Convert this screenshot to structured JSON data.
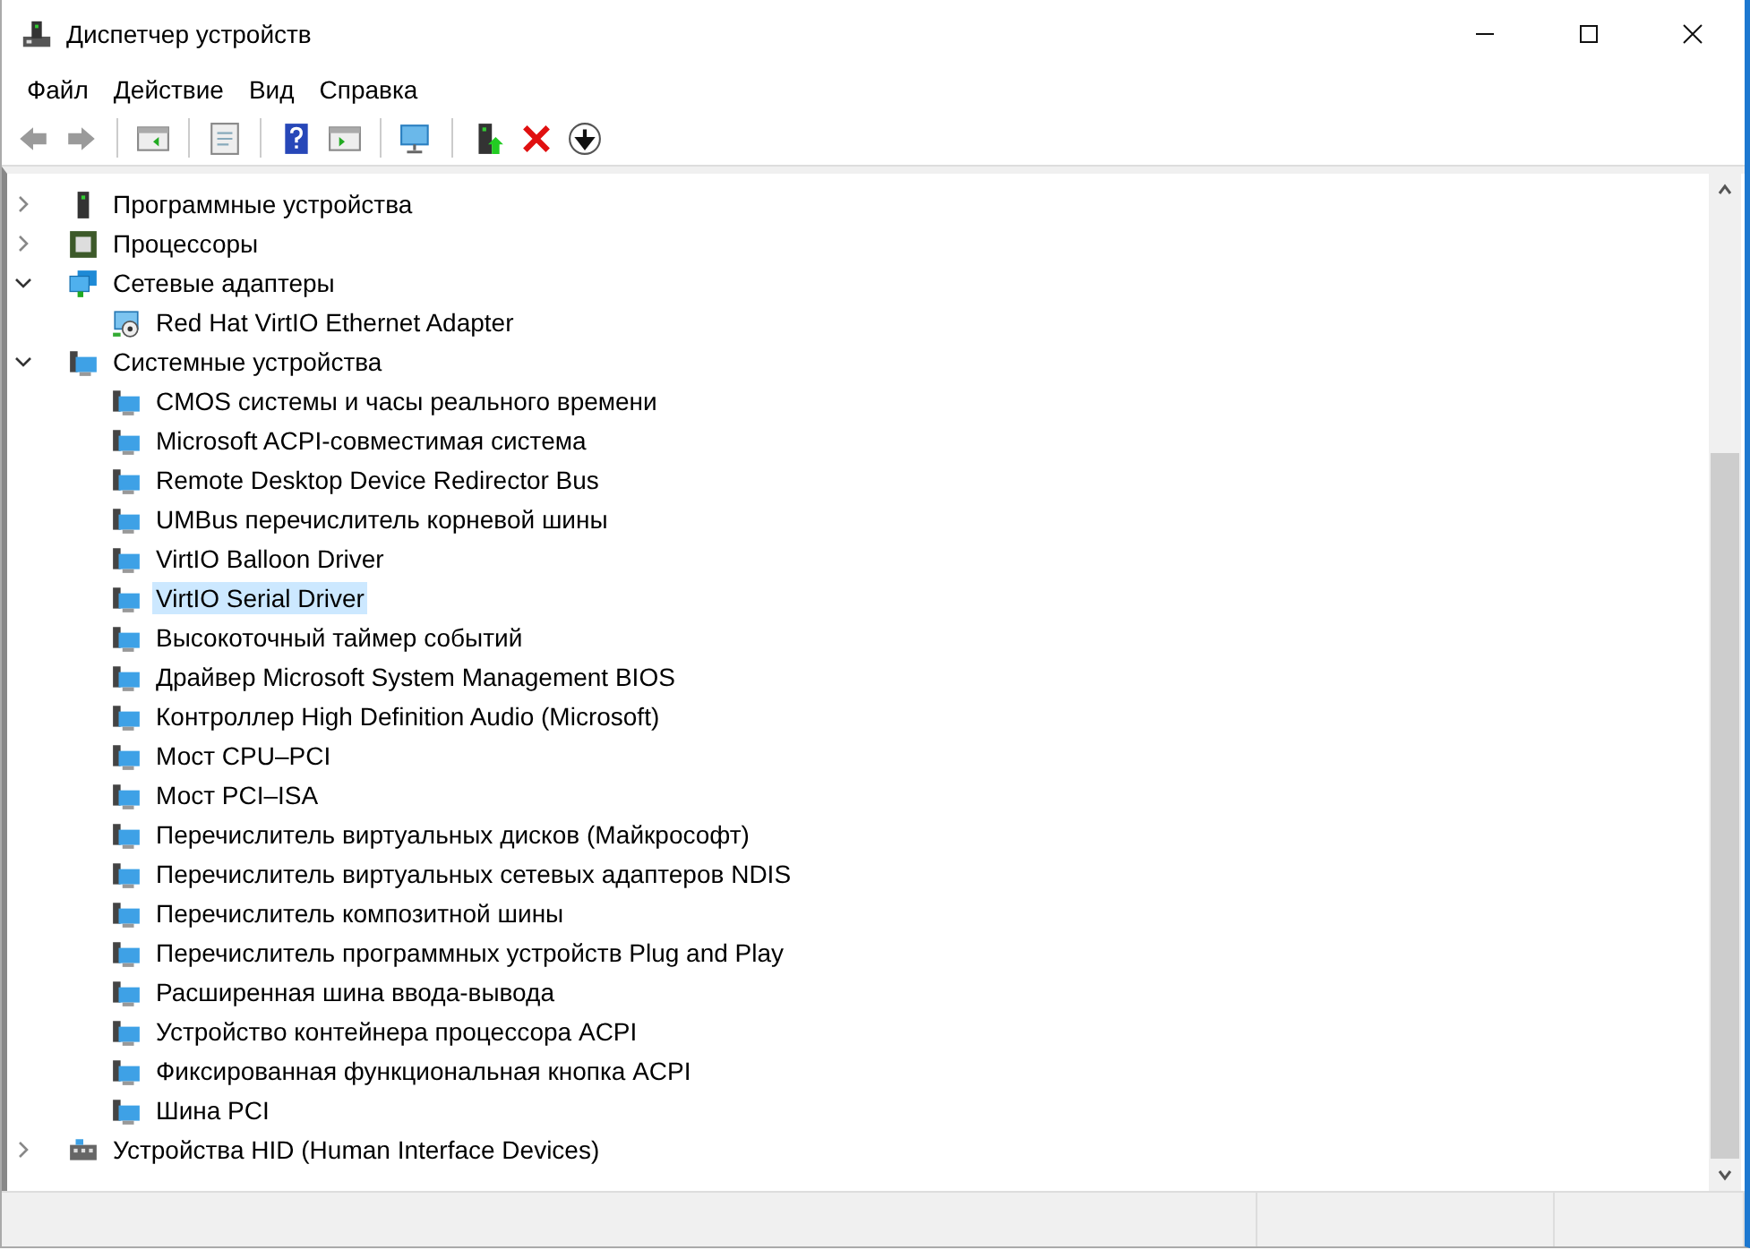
{
  "window": {
    "title": "Диспетчер устройств"
  },
  "menu": [
    "Файл",
    "Действие",
    "Вид",
    "Справка"
  ],
  "tree": [
    {
      "label": "Программные устройства",
      "kind": "firmware",
      "expanded": false,
      "selected": false
    },
    {
      "label": "Процессоры",
      "kind": "processor",
      "expanded": false,
      "selected": false
    },
    {
      "label": "Сетевые адаптеры",
      "kind": "network",
      "expanded": true,
      "selected": false,
      "children": [
        {
          "label": "Red Hat VirtIO Ethernet Adapter",
          "kind": "adapter",
          "selected": false
        }
      ]
    },
    {
      "label": "Системные устройства",
      "kind": "system",
      "expanded": true,
      "selected": false,
      "children": [
        {
          "label": "CMOS системы и часы реального времени",
          "kind": "device",
          "selected": false
        },
        {
          "label": "Microsoft ACPI-совместимая система",
          "kind": "device",
          "selected": false
        },
        {
          "label": "Remote Desktop Device Redirector Bus",
          "kind": "device",
          "selected": false
        },
        {
          "label": "UMBus перечислитель корневой шины",
          "kind": "device",
          "selected": false
        },
        {
          "label": "VirtIO Balloon Driver",
          "kind": "device",
          "selected": false
        },
        {
          "label": "VirtIO Serial Driver",
          "kind": "device",
          "selected": true
        },
        {
          "label": "Высокоточный таймер событий",
          "kind": "device",
          "selected": false
        },
        {
          "label": "Драйвер Microsoft System Management BIOS",
          "kind": "device",
          "selected": false
        },
        {
          "label": "Контроллер High Definition Audio (Microsoft)",
          "kind": "device",
          "selected": false
        },
        {
          "label": "Мост CPU–PCI",
          "kind": "device",
          "selected": false
        },
        {
          "label": "Мост PCI–ISA",
          "kind": "device",
          "selected": false
        },
        {
          "label": "Перечислитель виртуальных дисков (Майкрософт)",
          "kind": "device",
          "selected": false
        },
        {
          "label": "Перечислитель виртуальных сетевых адаптеров NDIS",
          "kind": "device",
          "selected": false
        },
        {
          "label": "Перечислитель композитной шины",
          "kind": "device",
          "selected": false
        },
        {
          "label": "Перечислитель программных устройств Plug and Play",
          "kind": "device",
          "selected": false
        },
        {
          "label": "Расширенная шина ввода-вывода",
          "kind": "device",
          "selected": false
        },
        {
          "label": "Устройство контейнера процессора ACPI",
          "kind": "device",
          "selected": false
        },
        {
          "label": "Фиксированная функциональная кнопка ACPI",
          "kind": "device",
          "selected": false
        },
        {
          "label": "Шина PCI",
          "kind": "device",
          "selected": false
        }
      ]
    },
    {
      "label": "Устройства HID (Human Interface Devices)",
      "kind": "hid",
      "expanded": false,
      "selected": false
    }
  ]
}
